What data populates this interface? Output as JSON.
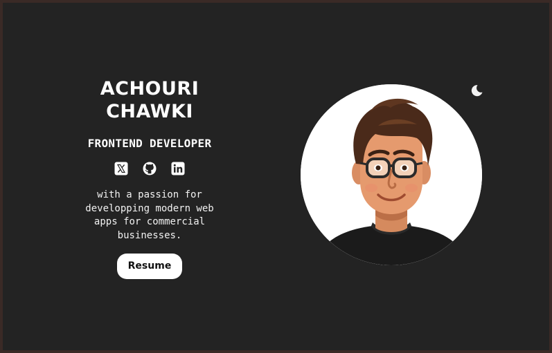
{
  "profile": {
    "name_line1": "ACHOURI",
    "name_line2": "CHAWKI",
    "role": "FRONTEND DEVELOPER",
    "bio_lines": [
      "with a passion for",
      "developping modern web",
      "apps for commercial",
      "businesses."
    ],
    "resume_label": "Resume"
  },
  "socials": [
    {
      "name": "x-icon"
    },
    {
      "name": "github-icon"
    },
    {
      "name": "linkedin-icon"
    }
  ],
  "theme": {
    "toggle_icon": "moon-icon"
  },
  "colors": {
    "page_background": "#232323",
    "text": "#ffffff",
    "button_background": "#ffffff",
    "button_text": "#111111"
  }
}
